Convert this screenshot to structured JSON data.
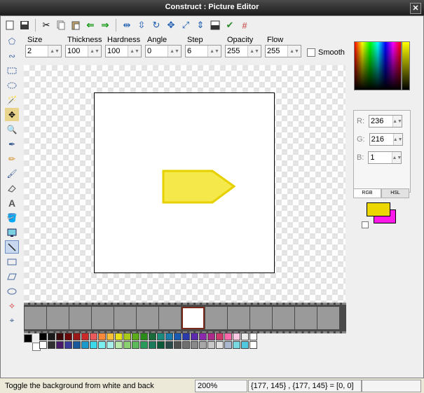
{
  "window": {
    "title": "Construct : Picture Editor",
    "close_label": "✕"
  },
  "toolbar": {
    "icons": [
      "new-icon",
      "save-icon",
      "cut-icon",
      "copy-icon",
      "paste-icon",
      "undo-icon",
      "redo-icon",
      "flip-horizontal-icon",
      "flip-vertical-icon",
      "rotate-icon",
      "crop-icon",
      "resize-icon",
      "hotspot-icon",
      "mask-icon",
      "apply-icon",
      "grid-icon"
    ]
  },
  "params": {
    "size": {
      "label": "Size",
      "value": "2"
    },
    "thickness": {
      "label": "Thickness",
      "value": "100"
    },
    "hardness": {
      "label": "Hardness",
      "value": "100"
    },
    "angle": {
      "label": "Angle",
      "value": "0"
    },
    "step": {
      "label": "Step",
      "value": "6"
    },
    "opacity": {
      "label": "Opacity",
      "value": "255"
    },
    "flow": {
      "label": "Flow",
      "value": "255"
    },
    "smooth": {
      "label": "Smooth",
      "checked": false
    }
  },
  "colors": {
    "r": {
      "label": "R:",
      "value": "236"
    },
    "g": {
      "label": "G:",
      "value": "216"
    },
    "b": {
      "label": "B:",
      "value": "1"
    },
    "tabs": [
      "RGB",
      "HSL"
    ],
    "primary": "#ecd800",
    "secondary": "#ff18e8"
  },
  "status": {
    "message": "Toggle the background from white and back",
    "zoom": "200%",
    "coords": "{177, 145} , {177, 145} = [0, 0]"
  },
  "sprite": {
    "fill": "#f5e84a",
    "stroke": "#e6d000"
  }
}
